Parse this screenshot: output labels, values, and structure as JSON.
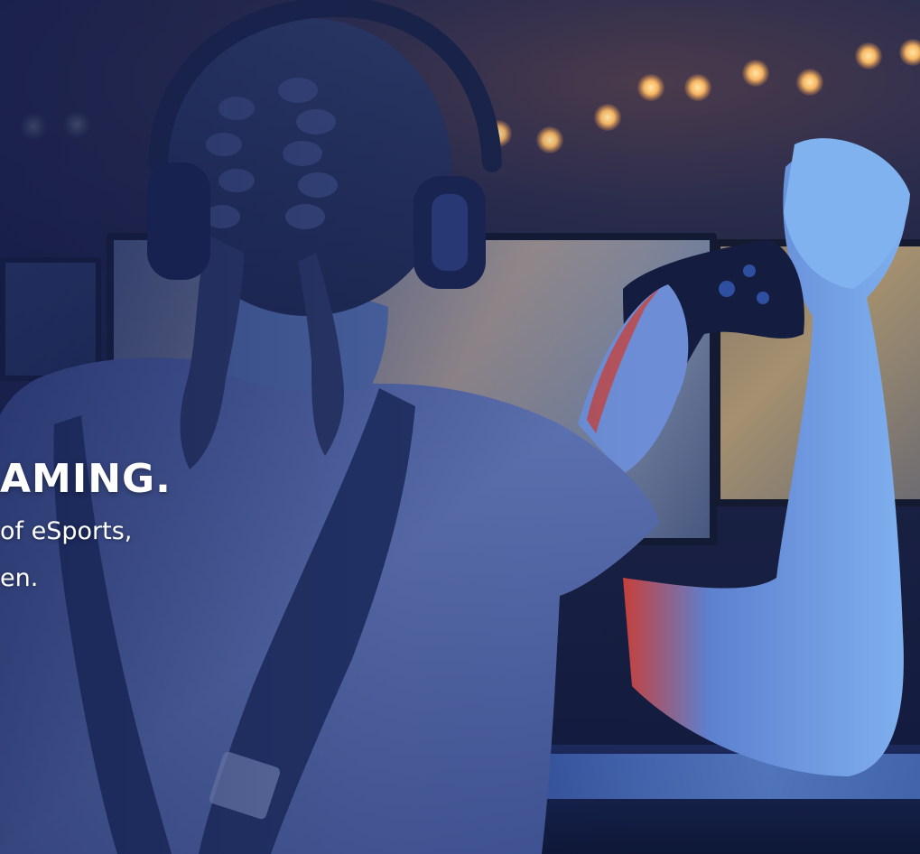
{
  "hero": {
    "headline": "AMING.",
    "subline_1": " of eSports,",
    "subline_2": "en."
  },
  "colors": {
    "background": "#1d2346",
    "text": "#ffffff",
    "light_bulb": "#f7b763",
    "shirt": "#5b6fa8",
    "glow_blue": "#4a8ad8",
    "glow_red": "#c8403a"
  }
}
